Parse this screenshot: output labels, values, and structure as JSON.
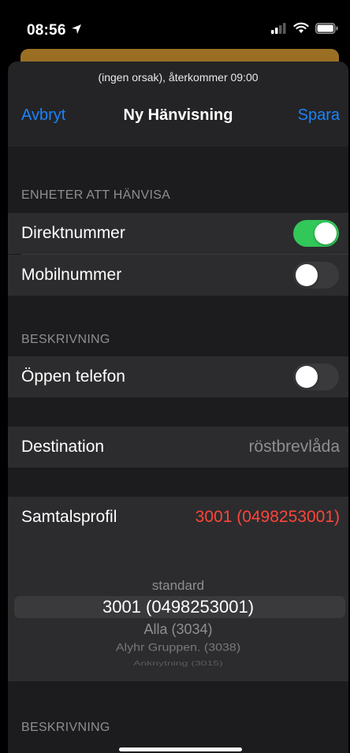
{
  "status_bar": {
    "time": "08:56",
    "colors": {
      "icons": "#ffffff"
    }
  },
  "header": {
    "subtitle": "(ingen orsak), återkommer 09:00",
    "cancel_label": "Avbryt",
    "title": "Ny Hänvisning",
    "save_label": "Spara",
    "accent_color": "#1a84ff"
  },
  "sections": {
    "units_header": "ENHETER ATT HÄNVISA",
    "description_header": "BESKRIVNING",
    "description_header_2": "BESKRIVNING"
  },
  "units": [
    {
      "label": "Direktnummer",
      "enabled": true
    },
    {
      "label": "Mobilnummer",
      "enabled": false
    }
  ],
  "description": {
    "open_phone_label": "Öppen telefon",
    "open_phone_enabled": false
  },
  "destination": {
    "label": "Destination",
    "value": "röstbrevlåda"
  },
  "call_profile": {
    "label": "Samtalsprofil",
    "value": "3001 (0498253001)",
    "value_color": "#ff453a",
    "picker_options": [
      "standard",
      "3001 (0498253001)",
      "Alla (3034)",
      "Alyhr Gruppen. (3038)",
      "Anknytning (3015)"
    ],
    "selected_index": 1
  },
  "toggle_colors": {
    "on": "#32c759",
    "off": "#3a3a3c"
  }
}
